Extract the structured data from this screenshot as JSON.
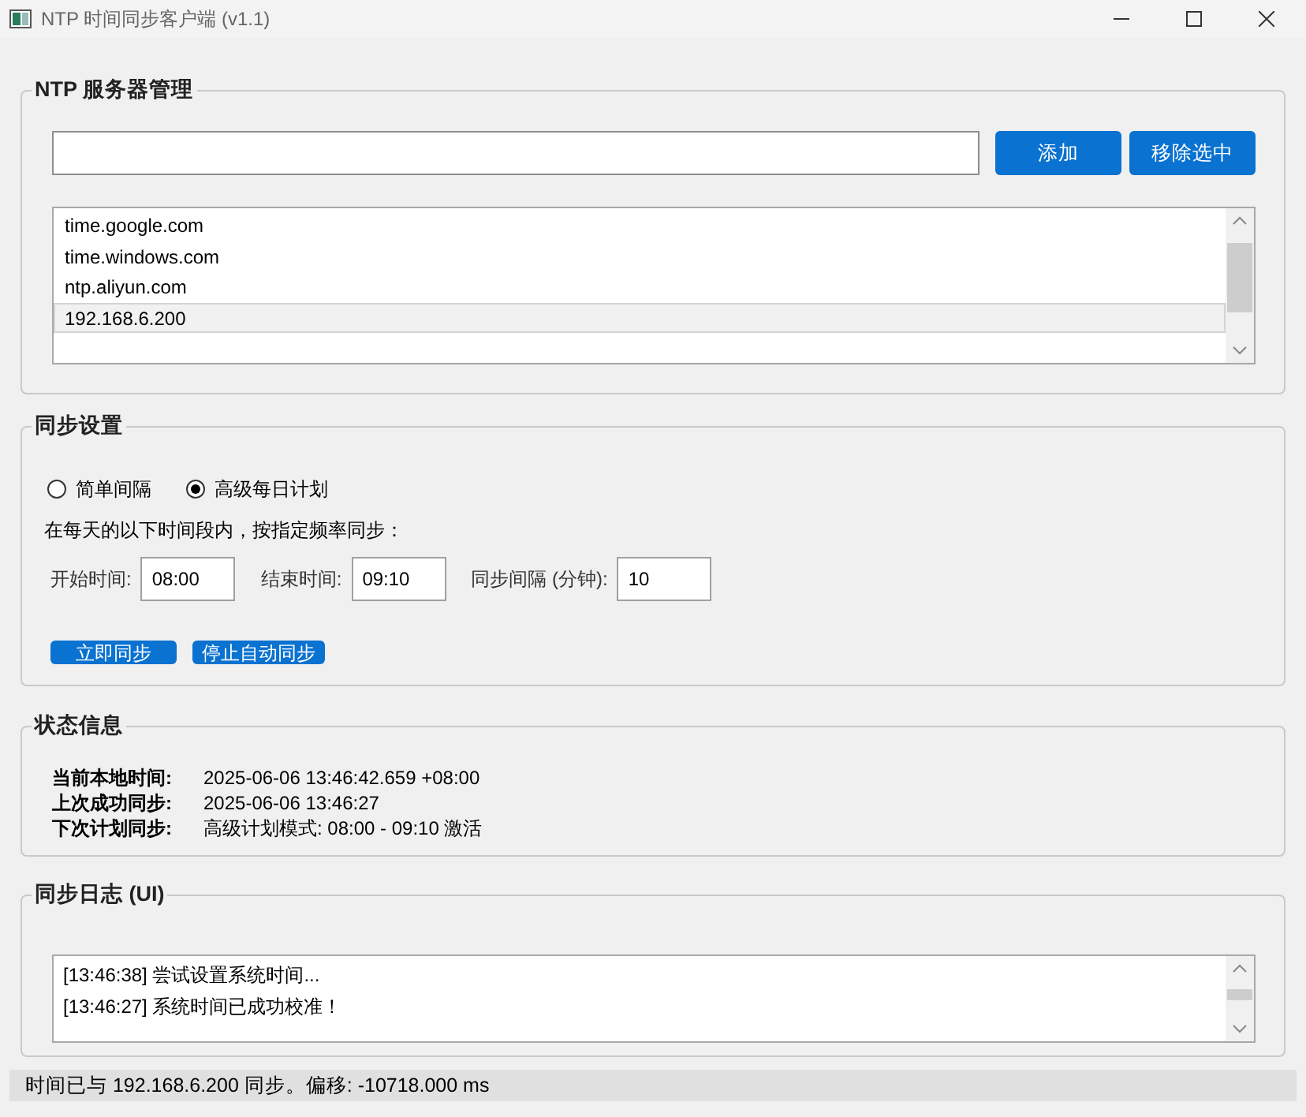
{
  "window": {
    "title": "NTP 时间同步客户端 (v1.1)"
  },
  "server_group": {
    "title": "NTP 服务器管理",
    "buttons": [
      "添加",
      "移除选中"
    ],
    "servers": [
      {
        "label": "time.google.com",
        "selected": false
      },
      {
        "label": "time.windows.com",
        "selected": false
      },
      {
        "label": "ntp.aliyun.com",
        "selected": false
      },
      {
        "label": "192.168.6.200",
        "selected": true
      }
    ]
  },
  "sync_group": {
    "title": "同步设置",
    "modes": [
      {
        "label": "简单间隔",
        "selected": false
      },
      {
        "label": "高级每日计划",
        "selected": true
      }
    ],
    "hint": "在每天的以下时间段内，按指定频率同步：",
    "fields": [
      {
        "label": "开始时间:",
        "value": "08:00"
      },
      {
        "label": "结束时间:",
        "value": "09:10"
      },
      {
        "label": "同步间隔 (分钟):",
        "value": "10"
      }
    ],
    "buttons": [
      "立即同步",
      "停止自动同步"
    ]
  },
  "status_group": {
    "title": "状态信息",
    "rows": [
      {
        "label": "当前本地时间:",
        "value": "2025-06-06 13:46:42.659 +08:00"
      },
      {
        "label": "上次成功同步:",
        "value": "2025-06-06 13:46:27"
      },
      {
        "label": "下次计划同步:",
        "value": "高级计划模式: 08:00 - 09:10 激活"
      }
    ]
  },
  "log_group": {
    "title": "同步日志 (UI)",
    "lines": [
      "[13:46:38] 尝试设置系统时间...",
      "[13:46:27] 系统时间已成功校准！"
    ]
  },
  "status_bar": "时间已与 192.168.6.200 同步。偏移: -10718.000 ms"
}
